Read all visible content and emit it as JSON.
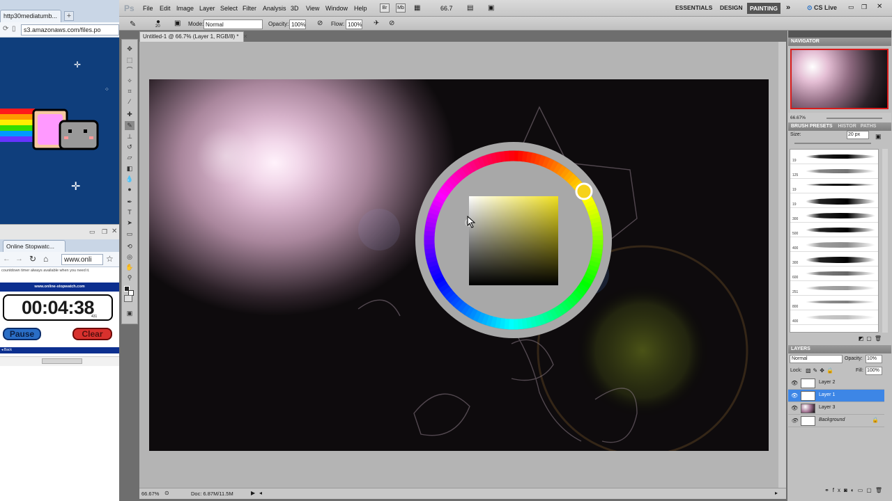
{
  "browser1": {
    "tab_title": "http30mediatumb...",
    "url": "s3.amazonaws.com/files.po"
  },
  "browser2": {
    "tab_title": "Online Stopwatc...",
    "url": "www.onli",
    "banner_text": "countdown timer always available when you need it.",
    "site": "www.online-stopwatch.com",
    "time": "00:04:38",
    "millis": "431",
    "pause_label": "Pause",
    "clear_label": "Clear",
    "back_label": "Back"
  },
  "photoshop": {
    "logo": "Ps",
    "menu": [
      "File",
      "Edit",
      "Image",
      "Layer",
      "Select",
      "Filter",
      "Analysis",
      "3D",
      "View",
      "Window",
      "Help"
    ],
    "zoom_menu": "66.7",
    "workspaces": [
      "ESSENTIALS",
      "DESIGN",
      "PAINTING"
    ],
    "cs_live": "CS Live",
    "options": {
      "brush_size": "20",
      "mode_label": "Mode:",
      "mode_value": "Normal",
      "opacity_label": "Opacity:",
      "opacity_value": "100%",
      "flow_label": "Flow:",
      "flow_value": "100%"
    },
    "doc_tab": "Untitled-1 @ 66.7% (Layer 1, RGB/8) *",
    "status": {
      "zoom": "66.67%",
      "doc": "Doc: 6.87M/11.5M"
    },
    "color_wheel": {
      "selected_hue": "#f6d21c",
      "square_color": "#f0e020"
    }
  },
  "panels": {
    "navigator": {
      "title": "NAVIGATOR",
      "zoom": "66.67%"
    },
    "brush_tabs": [
      "BRUSH PRESETS",
      "HISTOR",
      "PATHS"
    ],
    "size_label": "Size:",
    "size_value": "20 px",
    "brushes": [
      "19",
      "125",
      "19",
      "19",
      "300",
      "500",
      "400",
      "300",
      "600",
      "251",
      "800",
      "400"
    ],
    "layers": {
      "title": "LAYERS",
      "blend_mode": "Normal",
      "opacity_label": "Opacity:",
      "opacity_value": "10%",
      "lock_label": "Lock:",
      "fill_label": "Fill:",
      "fill_value": "100%",
      "items": [
        {
          "name": "Layer 2",
          "selected": false
        },
        {
          "name": "Layer 1",
          "selected": true
        },
        {
          "name": "Layer 3",
          "selected": false
        },
        {
          "name": "Background",
          "selected": false
        }
      ]
    }
  }
}
